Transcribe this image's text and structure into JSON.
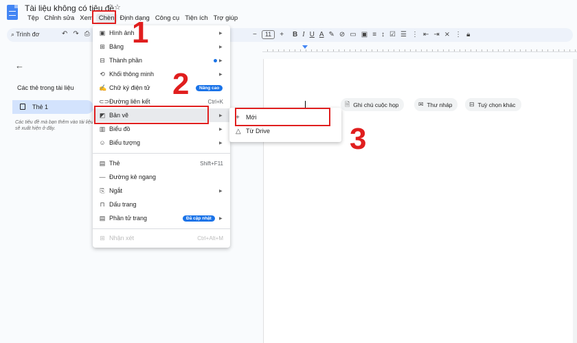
{
  "title": {
    "doc_name": "Tài liệu không có tiêu đề",
    "star_icon": "star-icon"
  },
  "menubar": [
    "Tệp",
    "Chỉnh sửa",
    "Xem",
    "Chèn",
    "Định dạng",
    "Công cụ",
    "Tiện ích",
    "Trợ giúp"
  ],
  "toolbar": {
    "search_label": "Trình đơ",
    "font_size": "11"
  },
  "sidebar": {
    "heading": "Các thẻ trong tài liệu",
    "tab_label": "Thẻ 1",
    "hint": "Các tiêu đề mà bạn thêm vào tài liệu sẽ xuất hiện ở đây."
  },
  "chips": [
    {
      "icon": "document-icon",
      "label": "Ghi chú cuộc họp"
    },
    {
      "icon": "email-icon",
      "label": "Thư nháp"
    },
    {
      "icon": "options-icon",
      "label": "Tuỳ chọn khác"
    }
  ],
  "insert_menu": {
    "items": [
      {
        "label": "Hình ảnh",
        "icon": "image-icon",
        "submenu": true
      },
      {
        "label": "Bảng",
        "icon": "table-icon",
        "submenu": true
      },
      {
        "label": "Thành phần",
        "icon": "components-icon",
        "submenu": true,
        "dot": true
      },
      {
        "label": "Khối thông minh",
        "icon": "smart-block-icon",
        "submenu": true
      },
      {
        "label": "Chữ ký điện tử",
        "icon": "signature-icon",
        "badge": "Nâng cao"
      },
      {
        "label": "Đường liên kết",
        "icon": "link-icon",
        "shortcut": "Ctrl+K"
      },
      {
        "label": "Bản vẽ",
        "icon": "drawing-icon",
        "submenu": true
      },
      {
        "label": "Biểu đồ",
        "icon": "chart-icon",
        "submenu": true
      },
      {
        "label": "Biểu tượng",
        "icon": "emoji-icon",
        "submenu": true
      },
      {
        "label": "Thẻ",
        "icon": "tab-icon",
        "shortcut": "Shift+F11"
      },
      {
        "label": "Đường kẻ ngang",
        "icon": "horizontal-line-icon"
      },
      {
        "label": "Ngắt",
        "icon": "break-icon",
        "submenu": true
      },
      {
        "label": "Dấu trang",
        "icon": "bookmark-icon"
      },
      {
        "label": "Phần tử trang",
        "icon": "page-elements-icon",
        "submenu": true,
        "badge": "Đã cập nhật"
      },
      {
        "label": "Nhận xét",
        "icon": "comment-icon",
        "shortcut": "Ctrl+Alt+M",
        "disabled": true
      }
    ]
  },
  "drawing_submenu": [
    {
      "label": "Mới",
      "icon": "plus-icon"
    },
    {
      "label": "Từ Drive",
      "icon": "drive-icon"
    }
  ],
  "steps": [
    "1",
    "2",
    "3"
  ],
  "colors": {
    "accent": "#1a73e8",
    "highlight": "#e01e1e",
    "brand": "#4285f4"
  }
}
